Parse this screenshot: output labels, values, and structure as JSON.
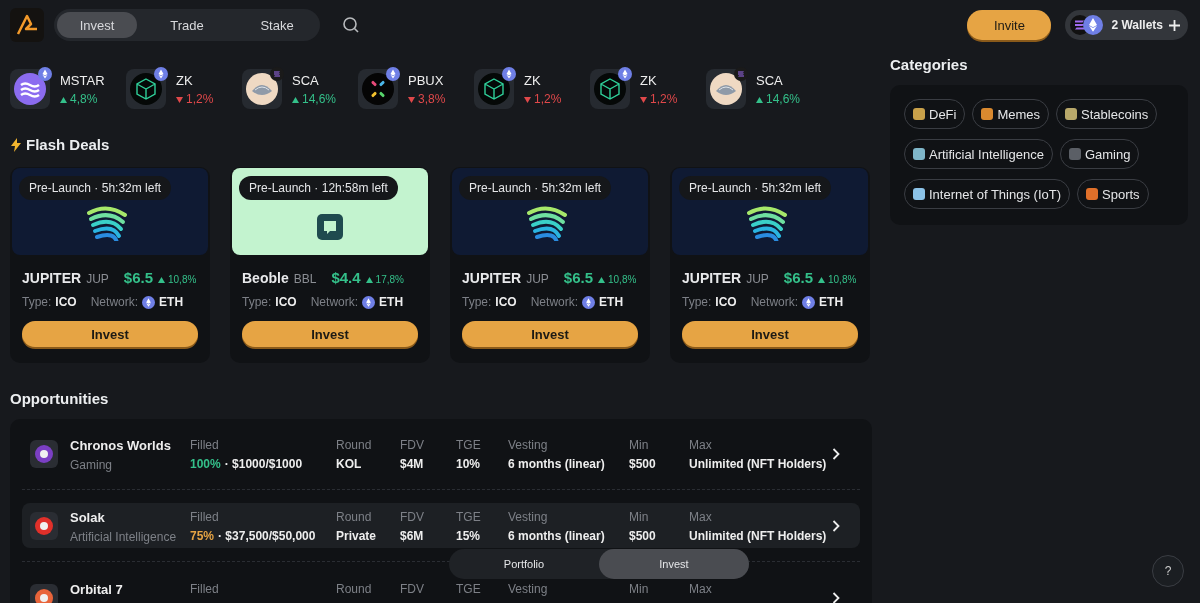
{
  "nav": {
    "tabs": [
      {
        "label": "Invest",
        "selected": true
      },
      {
        "label": "Trade",
        "selected": false
      },
      {
        "label": "Stake",
        "selected": false
      }
    ]
  },
  "header": {
    "invite": "Invite",
    "wallets": "2 Wallets"
  },
  "ticker": [
    {
      "symbol": "MSTAR",
      "change": "4,8%",
      "rising": true,
      "kind": "waves",
      "solana_chain": false
    },
    {
      "symbol": "ZK",
      "change": "1,2%",
      "rising": false,
      "kind": "hex",
      "solana_chain": false
    },
    {
      "symbol": "SCA",
      "change": "14,6%",
      "rising": true,
      "kind": "shell",
      "solana_chain": true
    },
    {
      "symbol": "PBUX",
      "change": "3,8%",
      "rising": false,
      "kind": "cross",
      "solana_chain": false
    },
    {
      "symbol": "ZK",
      "change": "1,2%",
      "rising": false,
      "kind": "hex",
      "solana_chain": false
    },
    {
      "symbol": "ZK",
      "change": "1,2%",
      "rising": false,
      "kind": "hex",
      "solana_chain": false
    },
    {
      "symbol": "SCA",
      "change": "14,6%",
      "rising": true,
      "kind": "shell",
      "solana_chain": true
    }
  ],
  "flash_deals": {
    "title": "Flash Deals",
    "cards": [
      {
        "kind": "dark",
        "timer": "Pre-Launch · 5h:32m left",
        "name": "JUPITER",
        "symbol": "JUP",
        "price": "$6.5",
        "change": "10,8%",
        "type_label": "Type:",
        "type": "ICO",
        "network_label": "Network:",
        "network": "ETH",
        "button": "Invest"
      },
      {
        "kind": "mint",
        "timer": "Pre-Launch · 12h:58m left",
        "name": "Beoble",
        "symbol": "BBL",
        "price": "$4.4",
        "change": "17,8%",
        "type_label": "Type:",
        "type": "ICO",
        "network_label": "Network:",
        "network": "ETH",
        "button": "Invest"
      },
      {
        "kind": "dark",
        "timer": "Pre-Launch · 5h:32m left",
        "name": "JUPITER",
        "symbol": "JUP",
        "price": "$6.5",
        "change": "10,8%",
        "type_label": "Type:",
        "type": "ICO",
        "network_label": "Network:",
        "network": "ETH",
        "button": "Invest"
      },
      {
        "kind": "dark",
        "timer": "Pre-Launch · 5h:32m left",
        "name": "JUPITER",
        "symbol": "JUP",
        "price": "$6.5",
        "change": "10,8%",
        "type_label": "Type:",
        "type": "ICO",
        "network_label": "Network:",
        "network": "ETH",
        "button": "Invest"
      }
    ]
  },
  "categories": {
    "title": "Categories",
    "items": [
      {
        "label": "DeFi",
        "color": "#c9a14a"
      },
      {
        "label": "Memes",
        "color": "#d9892f"
      },
      {
        "label": "Stablecoins",
        "color": "#b8a86a"
      },
      {
        "label": "Artificial Intelligence",
        "color": "#7fb6c9"
      },
      {
        "label": "Gaming",
        "color": "#5b5f66"
      },
      {
        "label": "Internet of Things (IoT)",
        "color": "#8cc3e8"
      },
      {
        "label": "Sports",
        "color": "#e0702a"
      }
    ]
  },
  "opportunities": {
    "title": "Opportunities",
    "rows": [
      {
        "name": "Chronos Worlds",
        "category": "Gaming",
        "color": "#7b3fc4",
        "selected": false,
        "filled_label": "Filled",
        "filled_pct": "100%",
        "complete": true,
        "filled_amount": "· $1000/$1000",
        "fields": [
          {
            "label": "Round",
            "value": "KOL"
          },
          {
            "label": "FDV",
            "value": "$4M"
          },
          {
            "label": "TGE",
            "value": "10%"
          },
          {
            "label": "Vesting",
            "value": "6 months (linear)"
          },
          {
            "label": "Min",
            "value": "$500"
          },
          {
            "label": "Max",
            "value": "Unlimited (NFT Holders)"
          }
        ]
      },
      {
        "name": "Solak",
        "category": "Artificial Intelligence",
        "color": "#e0302a",
        "selected": true,
        "filled_label": "Filled",
        "filled_pct": "75%",
        "complete": false,
        "filled_amount": "· $37,500/$50,000",
        "fields": [
          {
            "label": "Round",
            "value": "Private"
          },
          {
            "label": "FDV",
            "value": "$6M"
          },
          {
            "label": "TGE",
            "value": "15%"
          },
          {
            "label": "Vesting",
            "value": "6 months (linear)"
          },
          {
            "label": "Min",
            "value": "$500"
          },
          {
            "label": "Max",
            "value": "Unlimited (NFT Holders)"
          }
        ]
      },
      {
        "name": "Orbital 7",
        "color": "#e8643a",
        "selected": false,
        "filled_label": "Filled",
        "fields": [
          {
            "label": "Round"
          },
          {
            "label": "FDV"
          },
          {
            "label": "TGE"
          },
          {
            "label": "Vesting"
          },
          {
            "label": "Min"
          },
          {
            "label": "Max"
          }
        ]
      }
    ]
  },
  "bottom_nav": {
    "tabs": [
      {
        "label": "Portfolio",
        "selected": false
      },
      {
        "label": "Invest",
        "selected": true
      }
    ]
  },
  "help": "?"
}
